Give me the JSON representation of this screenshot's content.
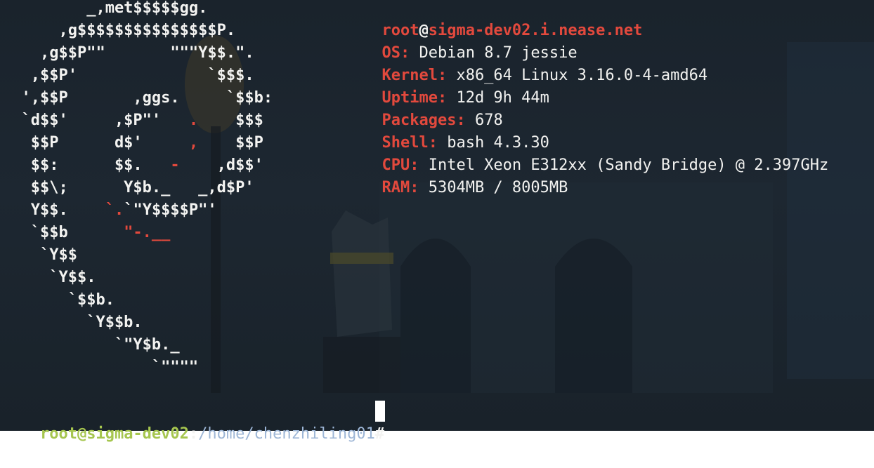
{
  "logo": {
    "lines": [
      [
        "         _,met$$$$$gg.",
        ""
      ],
      [
        "      ,g$$$$$$$$$$$$$$$P.",
        ""
      ],
      [
        "    ,g$$P\"\"       \"\"\"Y$$.\".",
        ""
      ],
      [
        "   ,$$P'              `$$$.",
        ""
      ],
      [
        "  ',$$P       ,ggs.     `$$b:",
        ""
      ],
      [
        "  `d$$'     ,$P\"'   ",
        ".",
        "    $$$"
      ],
      [
        "   $$P      d$'     ",
        ",",
        "    $$P"
      ],
      [
        "   $$:      $$.   ",
        "-",
        "    ,d$$'"
      ],
      [
        "   $$\\;      Y$b._   _,d$P'",
        ""
      ],
      [
        "   Y$$.    ",
        "`.",
        "`\"Y$$$$P\"'"
      ],
      [
        "   `$$b      ",
        "\"-.__",
        ""
      ],
      [
        "    `Y$$",
        ""
      ],
      [
        "     `Y$$.",
        ""
      ],
      [
        "       `$$b.",
        ""
      ],
      [
        "         `Y$$b.",
        ""
      ],
      [
        "            `\"Y$b._",
        ""
      ],
      [
        "                `\"\"\"\"",
        ""
      ]
    ]
  },
  "info": {
    "user": "root",
    "at": "@",
    "host": "sigma-dev02.i.nease.net",
    "rows": [
      {
        "key": "OS:",
        "value": " Debian 8.7 jessie"
      },
      {
        "key": "Kernel:",
        "value": " x86_64 Linux 3.16.0-4-amd64"
      },
      {
        "key": "Uptime:",
        "value": " 12d 9h 44m"
      },
      {
        "key": "Packages:",
        "value": " 678"
      },
      {
        "key": "Shell:",
        "value": " bash 4.3.30"
      },
      {
        "key": "CPU:",
        "value": " Intel Xeon E312xx (Sandy Bridge) @ 2.397GHz"
      },
      {
        "key": "RAM:",
        "value": " 5304MB / 8005MB"
      }
    ]
  },
  "prompt": {
    "user_host": "root@sigma-dev02",
    "colon": ":",
    "path": "/home/chenzhiling01",
    "symbol": "# "
  },
  "colors": {
    "accent_red": "#e2493d",
    "prompt_green": "#a6c64f",
    "path_blue": "#9db6d6",
    "background": "#1d2731"
  }
}
